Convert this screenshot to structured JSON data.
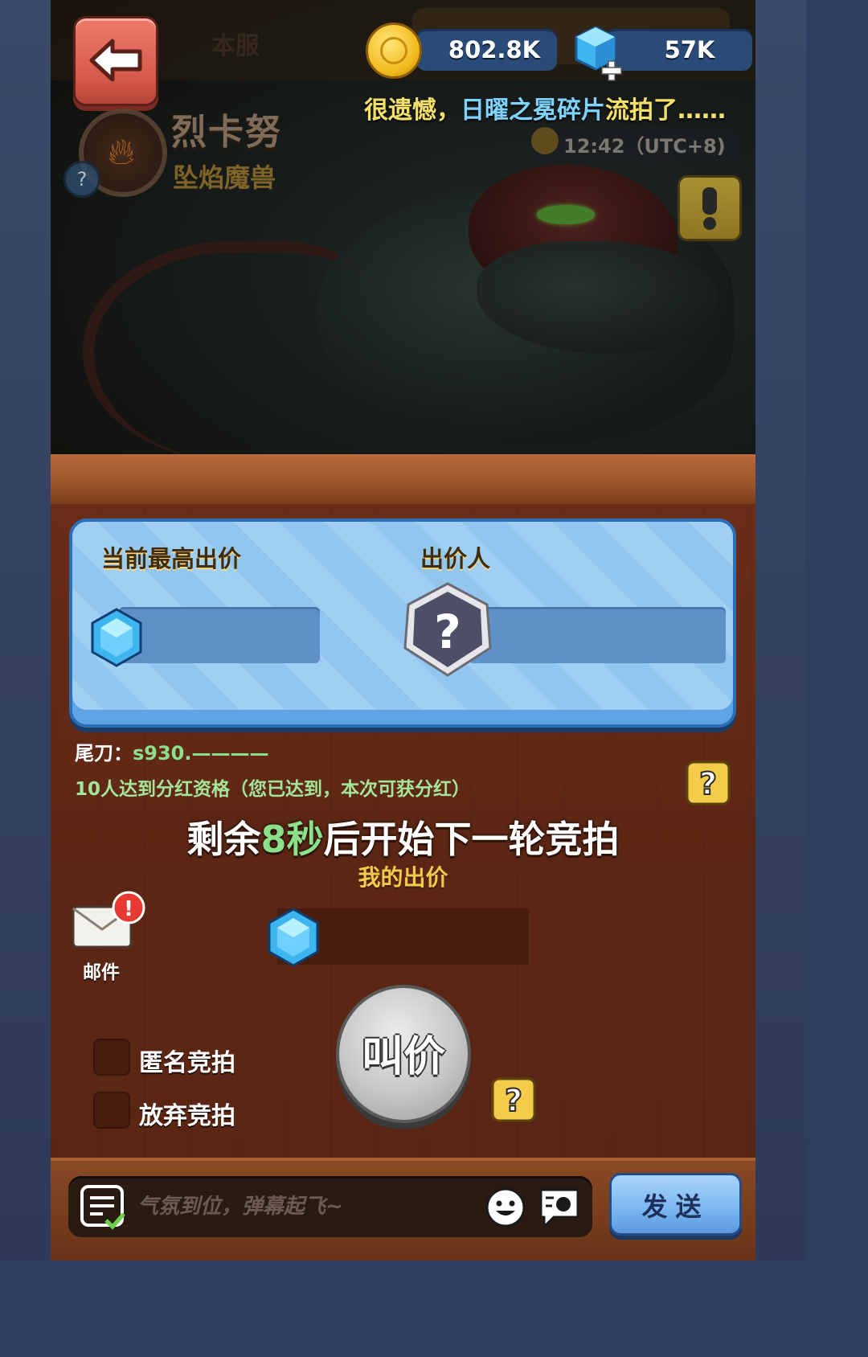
{
  "header": {
    "server_tab": "本服",
    "coins": "802.8K",
    "gems": "57K"
  },
  "ticker": {
    "part1": "很遗憾，",
    "part2": "日曜之冕碎片",
    "part3": "流拍了……"
  },
  "boss": {
    "name": "烈卡努",
    "title": "坠焰魔兽",
    "time": "12:42（UTC+8)"
  },
  "bid_card": {
    "highest_bid_label": "当前最高出价",
    "bidder_label": "出价人",
    "bidder_avatar_glyph": "?"
  },
  "auction": {
    "tail_label": "尾刀：",
    "tail_value": "s930.————",
    "share_main": "10人达到分红资格",
    "share_note": "（您已达到，本次可获分红）",
    "countdown_prefix": "剩余",
    "countdown_seconds": "8秒",
    "countdown_suffix": "后开始下一轮竞拍",
    "my_bid_label": "我的出价"
  },
  "mail": {
    "label": "邮件",
    "badge": "!"
  },
  "options": {
    "anonymous": "匿名竞拍",
    "give_up": "放弃竞拍"
  },
  "actions": {
    "bid_button": "叫价",
    "help_glyph": "?"
  },
  "chat": {
    "placeholder": "气氛到位，弹幕起飞~",
    "send": "发送"
  },
  "colors": {
    "accent_green": "#8be08a",
    "accent_gold": "#f2c94a",
    "ticker_blue": "#7fd3ff",
    "card_blue": "#9fd0f4",
    "back_red": "#d65a4b"
  }
}
